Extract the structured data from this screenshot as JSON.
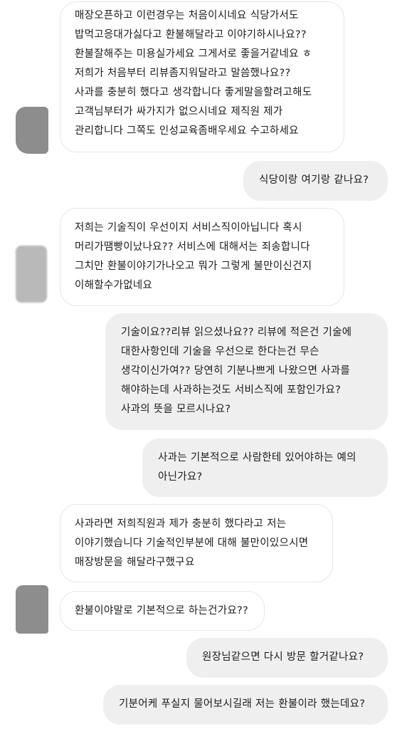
{
  "messages": [
    {
      "side": "incoming",
      "text": "매장오픈하고 이런경우는 처음이시네요 식당가서도\n밥먹고응대가싫다고 환불해달라고 이야기하시나요??\n환불잘해주는 미용실가세요 그게서로 좋을거같네요 ㅎ\n저희가 처음부터 리뷰좀지워달라고 말씀했나요??\n사과를 충분히 했다고 생각합니다 좋게말을할려고해도\n고객님부터가 싸가지가 없으시네요  제직원 제가\n관리합니다 그쪽도 인성교육좀배우세요 수고하세요"
    },
    {
      "side": "outgoing",
      "text": "식당이랑 여기랑 같나요?"
    },
    {
      "side": "incoming",
      "text": "저희는 기술직이 우선이지 서비스직이아닙니다 혹시\n머리가땜빵이났나요?? 서비스에 대해서는 죄송합니다\n그치만 환불이야기가나오고 뭐가 그렇게 불만이신건지\n이해할수가없네요"
    },
    {
      "side": "outgoing",
      "text": "기술이요??리뷰 읽으셨나요?? 리뷰에 적은건 기술에\n대한사항인데 기술을 우선으로 한다는건 무슨\n생각이신가여?? 당연히 기분나쁘게 나왔으면 사과를\n해야하는데 사과하는것도 서비스직에 포함인가요?\n사과의 뜻을 모르시나요?"
    },
    {
      "side": "outgoing",
      "text": "사과는 기본적으로 사람한테 있어야하는 예의\n아닌가요?"
    },
    {
      "side": "incoming",
      "text": "사과라면 저희직원과 제가 충분히 했다라고 저는\n이야기했습니다 기술적인부분에 대해 불만이있으시면\n매장방문을 해달라구했구요"
    },
    {
      "side": "incoming",
      "text": "환불이야말로 기본적으로 하는건가요??"
    },
    {
      "side": "outgoing",
      "text": "원장님같으면 다시 방문 할거같나요?"
    },
    {
      "side": "outgoing",
      "text": "기분어케 푸실지 물어보시길래 저는 환불이라 했는데요?"
    }
  ],
  "avatars": [
    "profile-avatar",
    "profile-avatar",
    "profile-avatar"
  ]
}
